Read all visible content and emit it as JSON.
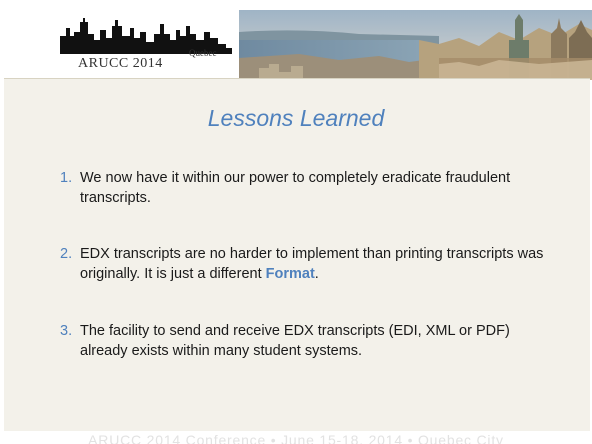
{
  "logo": {
    "place": "Quebec",
    "name": "ARUCC 2014"
  },
  "title": "Lessons Learned",
  "items": [
    {
      "num": "1.",
      "text": "We now have it within our power to completely eradicate fraudulent transcripts."
    },
    {
      "num": "2.",
      "text_before": "EDX transcripts are no harder to implement than printing transcripts was originally.  It is just a different ",
      "highlight": "Format",
      "text_after": "."
    },
    {
      "num": "3.",
      "text": "The facility to send and receive EDX transcripts (EDI, XML or PDF) already exists within many student systems."
    }
  ],
  "footer": "ARUCC 2014 Conference  •  June 15-18, 2014  •  Quebec City",
  "colors": {
    "accent": "#4f81bd",
    "panel": "#f3f1ea"
  }
}
